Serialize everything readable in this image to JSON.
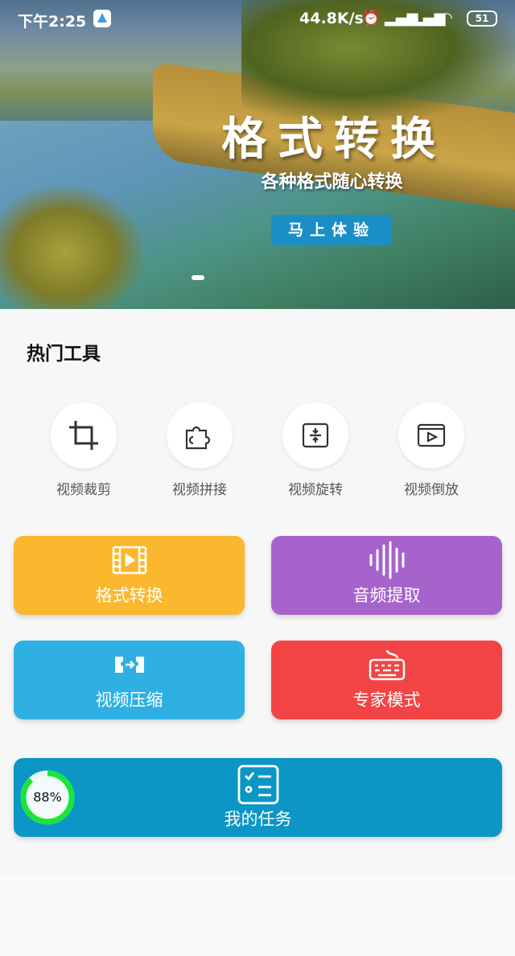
{
  "status_bar": {
    "time": "下午2:25",
    "net_speed": "44.8K/s",
    "battery": "51"
  },
  "banner": {
    "title": "格式转换",
    "subtitle": "各种格式随心转换",
    "cta": "马上体验"
  },
  "hot_tools": {
    "title": "热门工具",
    "items": [
      {
        "label": "视频裁剪",
        "icon": "crop-icon"
      },
      {
        "label": "视频拼接",
        "icon": "puzzle-icon"
      },
      {
        "label": "视频旋转",
        "icon": "rotate-icon"
      },
      {
        "label": "视频倒放",
        "icon": "reverse-play-icon"
      }
    ]
  },
  "cards": [
    {
      "label": "格式转换",
      "icon": "film-icon",
      "color": "#fbb72d"
    },
    {
      "label": "音频提取",
      "icon": "soundwave-icon",
      "color": "#a663cc"
    },
    {
      "label": "视频压缩",
      "icon": "compress-icon",
      "color": "#2fb0e3"
    },
    {
      "label": "专家模式",
      "icon": "keyboard-icon",
      "color": "#f24444"
    }
  ],
  "task": {
    "label": "我的任务",
    "progress_text": "88%",
    "progress": 0.88,
    "color": "#0b96c6",
    "ring_color": "#19e639"
  }
}
